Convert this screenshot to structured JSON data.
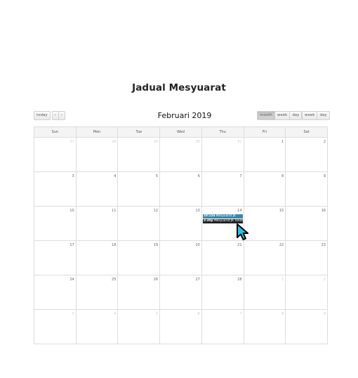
{
  "page": {
    "title": "Jadual Mesyuarat"
  },
  "toolbar": {
    "today": "today",
    "prev_icon": "chevron-left-icon",
    "next_icon": "chevron-right-icon",
    "month_title": "Februari 2019",
    "views_1": [
      "month",
      "week",
      "day"
    ],
    "views_2": [
      "week",
      "day"
    ],
    "active_view": "month"
  },
  "calendar": {
    "weekdays": [
      "Sun",
      "Mon",
      "Tue",
      "Wed",
      "Thu",
      "Fri",
      "Sat"
    ],
    "weeks": [
      [
        "27",
        "28",
        "29",
        "30",
        "31",
        "1",
        "2"
      ],
      [
        "3",
        "4",
        "5",
        "6",
        "7",
        "8",
        "9"
      ],
      [
        "10",
        "11",
        "12",
        "13",
        "14",
        "15",
        "16"
      ],
      [
        "17",
        "18",
        "19",
        "20",
        "21",
        "22",
        "23"
      ],
      [
        "24",
        "25",
        "26",
        "27",
        "28",
        "1",
        "2"
      ],
      [
        "3",
        "4",
        "5",
        "6",
        "7",
        "8",
        "9"
      ]
    ],
    "events": [
      {
        "time": "10:15a",
        "title": "Mesyuarat JK",
        "color": "#3a87ad"
      },
      {
        "time": "2:30p",
        "title": "Mesyuarat JK Tender",
        "color": "#222222"
      }
    ]
  }
}
